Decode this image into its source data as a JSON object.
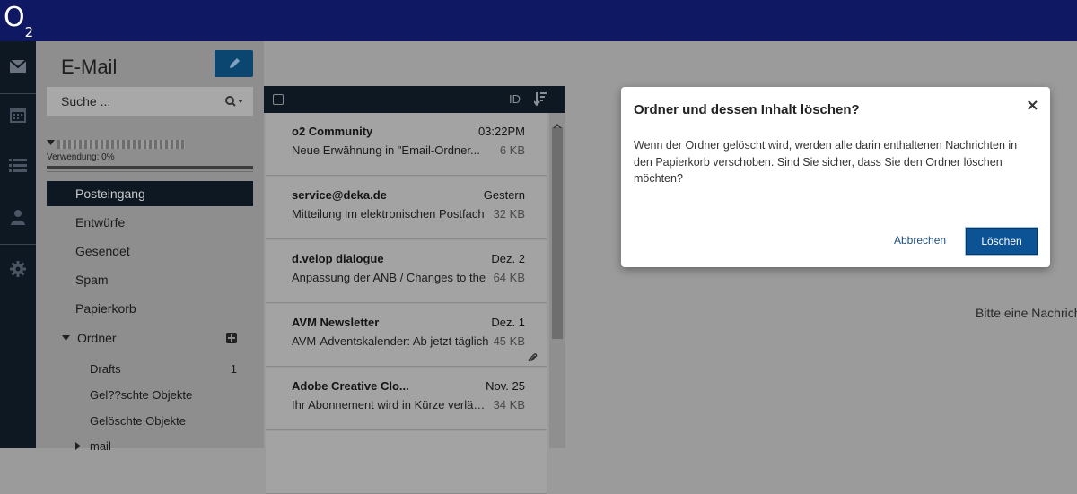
{
  "brand": {
    "logo_text": "O",
    "logo_sub": "2"
  },
  "rail": {
    "items": [
      {
        "name": "mail-icon"
      },
      {
        "name": "calendar-icon"
      },
      {
        "name": "list-icon"
      },
      {
        "name": "contact-icon"
      },
      {
        "name": "gear-icon"
      }
    ]
  },
  "sidebar": {
    "title": "E-Mail",
    "compose_icon": "pencil-icon",
    "search": {
      "placeholder": "Suche ..."
    },
    "account": {
      "usage": "Verwendung: 0%"
    },
    "folders": [
      {
        "label": "Posteingang",
        "active": true
      },
      {
        "label": "Entwürfe"
      },
      {
        "label": "Gesendet"
      },
      {
        "label": "Spam"
      },
      {
        "label": "Papierkorb"
      },
      {
        "label": "Ordner"
      }
    ],
    "subfolders": [
      {
        "label": "Drafts",
        "count": "1"
      },
      {
        "label": "Gel??schte Objekte",
        "count": ""
      },
      {
        "label": "Gelöschte Objekte",
        "count": ""
      },
      {
        "label": "mail",
        "count": ""
      }
    ]
  },
  "list": {
    "header": {
      "sort_label": "ID"
    },
    "messages": [
      {
        "sender": "o2 Community",
        "date": "03:22PM",
        "subject": "Neue Erwähnung in \"Email-Ordner...",
        "size": "6 KB",
        "attachment": false
      },
      {
        "sender": "service@deka.de",
        "date": "Gestern",
        "subject": "Mitteilung im elektronischen Postfach",
        "size": "32 KB",
        "attachment": false
      },
      {
        "sender": "d.velop dialogue",
        "date": "Dez. 2",
        "subject": "Anpassung der ANB / Changes to the",
        "size": "64 KB",
        "attachment": false
      },
      {
        "sender": "AVM Newsletter",
        "date": "Dez. 1",
        "subject": "AVM-Adventskalender: Ab jetzt täglich",
        "size": "45 KB",
        "attachment": true
      },
      {
        "sender": "Adobe Creative Clo...",
        "date": "Nov. 25",
        "subject": "Ihr Abonnement wird in Kürze verlängert",
        "size": "34 KB",
        "attachment": false
      }
    ]
  },
  "reading_pane": {
    "empty_text": "Bitte eine Nachricht"
  },
  "dialog": {
    "title": "Ordner und dessen Inhalt löschen?",
    "close": "×",
    "body": "Wenn der Ordner gelöscht wird, werden alle darin enthaltenen Nachrichten in den Papierkorb verschoben. Sind Sie sicher, dass Sie den Ordner löschen möchten?",
    "cancel_label": "Abbrechen",
    "confirm_label": "Löschen"
  }
}
